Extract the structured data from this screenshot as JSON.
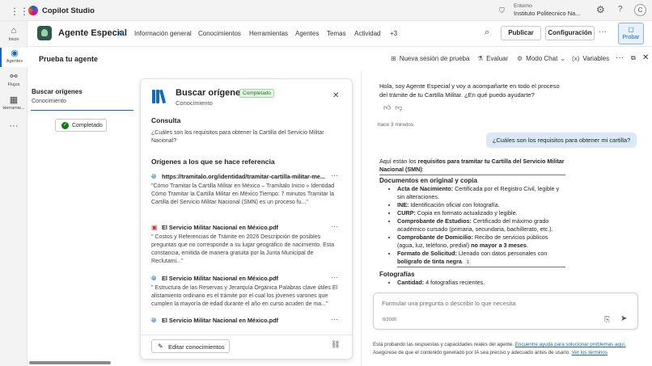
{
  "topbar": {
    "app_name": "Copilot Studio",
    "env_label": "Entorno",
    "env_value": "Instituto Politecnico Na...",
    "avatar_initial": "C",
    "icons": [
      "waffle-icon",
      "copilot-logo",
      "environment-icon",
      "gear-icon",
      "help-icon"
    ]
  },
  "rail": {
    "items": [
      {
        "label": "Inicio",
        "icon": "home-icon",
        "glyph": "⌂"
      },
      {
        "label": "Agentes",
        "icon": "agents-icon",
        "glyph": "◉"
      },
      {
        "label": "Flujos",
        "icon": "flows-icon",
        "glyph": "⚯"
      },
      {
        "label": "Herramie...",
        "icon": "tools-icon",
        "glyph": "▦"
      },
      {
        "label": "",
        "icon": "more-icon",
        "glyph": "···"
      }
    ]
  },
  "header": {
    "agent_name": "Agente Especial",
    "nav": [
      "Información general",
      "Conocimientos",
      "Herramientas",
      "Agentes",
      "Temas",
      "Actividad",
      "+3"
    ],
    "publish": "Publicar",
    "settings": "Configuración",
    "test": "Probar"
  },
  "testbar": {
    "title": "Prueba tu agente",
    "new_session": "Nueva sesión de prueba",
    "evaluate": "Evaluar",
    "chat_mode": "Modo Chat",
    "variables": "Variables"
  },
  "trace": {
    "title": "Buscar orígenes",
    "subtitle": "Conocimiento",
    "status": "Completado"
  },
  "card": {
    "title": "Buscar orígenes",
    "status": "Completado",
    "subtitle": "Conocimiento",
    "query_heading": "Consulta",
    "query_text": "¿Cuáles son los requisitos para obtener la Cartilla del Servicio Militar Nacional?",
    "sources_heading": "Orígenes a los que se hace referencia",
    "sources": [
      {
        "type": "web",
        "title": "https://tramitalo.org/identidad/tramitar-cartilla-militar-me...",
        "excerpt": "\"Cómo Tramitar la Cartilla Militar en México – Tramítalo Inicio » Identidad Cómo Tramitar la Cartilla Militar en México Tiempo: 7 minutos Tramitar la Cartilla del Servicio Militar Nacional (SMN) es un proceso fu...\""
      },
      {
        "type": "pdf",
        "title": "El Servicio Militar Nacional en México.pdf",
        "excerpt": "\" Costos y Referencias de Trámite en 2026 Descripción de posibles preguntas que no corresponde a su lugar geográfico de nacimiento. Esta constancia, emitida de manera gratuita por la Junta Municipal de Reclutami...\""
      },
      {
        "type": "web",
        "title": "El Servicio Militar Nacional en México.pdf",
        "excerpt": "\" Estructura de las Reservas y Jerarquía Orgánica Palabras clave útiles El alistamiento ordinario es el trámite por el cual los jóvenes varones que cumplen la mayoría de edad durante el año en curso acuden de ma...\""
      },
      {
        "type": "web",
        "title": "El Servicio Militar Nacional en México.pdf",
        "excerpt": ""
      }
    ],
    "edit_button": "Editar conocimientos"
  },
  "chat": {
    "greeting": "Hola, soy Agente Especial y voy a acompañarte en todo el proceso del trámite de tu Cartilla Militar. ¿En qué puedo ayudarte?",
    "time": "hace 3 minutos",
    "user_message": "¿Cuáles son los requisitos para obtener mi cartilla?",
    "response": {
      "intro": "Aquí están los ",
      "intro_bold": "requisitos para tramitar tu Cartilla del Servicio Militar Nacional (SMN)",
      "intro_end": ":",
      "section1": "Documentos en original y copia",
      "items": [
        {
          "b": "Acta de Nacimiento:",
          "t": " Certificada por el Registro Civil, legible y sin alteraciones."
        },
        {
          "b": "INE:",
          "t": " Identificación oficial con fotografía."
        },
        {
          "b": "CURP:",
          "t": " Copia en formato actualizado y legible."
        },
        {
          "b": "Comprobante de Estudios:",
          "t": " Certificado del máximo grado académico cursado (primaria, secundaria, bachillerato, etc.)."
        },
        {
          "b": "Comprobante de Domicilio:",
          "t": " Recibo de servicios públicos (agua, luz, teléfono, predial) "
        },
        {
          "b": "Formato de Solicitud:",
          "t": " Llenado con datos personales con "
        }
      ],
      "domicilio_bold": "no mayor a 3 meses",
      "formato_bold": "bolígrafo de tinta negra",
      "citation": "1",
      "section2": "Fotografías",
      "item2_b": "Cantidad:",
      "item2_t": " 4 fotografías recientes."
    },
    "composer_placeholder": "Formular una pregunta o describir lo que necesita",
    "char_count": "0/2000",
    "disclaimer_1": "Está probando las respuestas y capacidades reales del agente. ",
    "disclaimer_link1": "Encuentre ayuda para solucionar problemas aquí.",
    "disclaimer_2": "Asegúrese de que el contenido generado por IA sea preciso y adecuado antes de usarlo. ",
    "disclaimer_link2": "Ver los términos"
  },
  "colors": {
    "accent": "#0f6cbd",
    "success": "#107c10",
    "user_bubble": "#dbe9f7"
  }
}
